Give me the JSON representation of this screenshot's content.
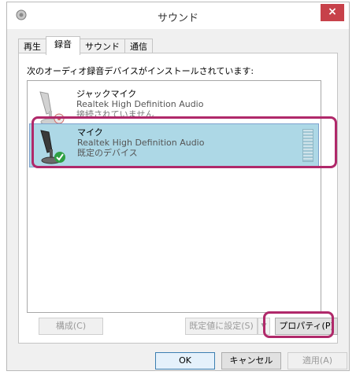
{
  "window": {
    "title": "サウンド",
    "close_glyph": "×"
  },
  "tabs": [
    {
      "label": "再生"
    },
    {
      "label": "録音"
    },
    {
      "label": "サウンド"
    },
    {
      "label": "通信"
    }
  ],
  "recording": {
    "description": "次のオーディオ録音デバイスがインストールされています:",
    "devices": [
      {
        "name": "ジャックマイク",
        "driver": "Realtek High Definition Audio",
        "status": "接続されていません",
        "icon": "microphone-icon",
        "badge": "disconnected-icon"
      },
      {
        "name": "マイク",
        "driver": "Realtek High Definition Audio",
        "status": "既定のデバイス",
        "icon": "microphone-icon",
        "badge": "default-check-icon"
      }
    ],
    "buttons": {
      "configure": "構成(C)",
      "set_default": "既定値に設定(S)",
      "set_default_arrow": "▼",
      "properties": "プロパティ(P)"
    }
  },
  "footer": {
    "ok": "OK",
    "cancel": "キャンセル",
    "apply": "適用(A)"
  },
  "colors": {
    "selection": "#add8e6",
    "highlight": "#b0296a",
    "close": "#c7414a"
  }
}
